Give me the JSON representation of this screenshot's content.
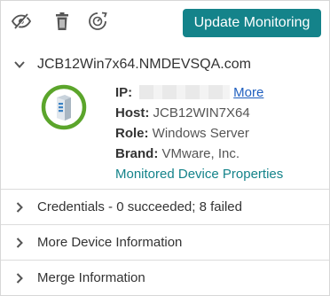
{
  "toolbar": {
    "hide_icon": "eye-slash-icon",
    "delete_icon": "trash-icon",
    "refresh_icon": "refresh-scan-icon",
    "update_button_label": "Update Monitoring",
    "accent_color": "#14838a"
  },
  "device": {
    "name": "JCB12Win7x64.NMDEVSQA.com",
    "expanded": true,
    "status_icon": "server-icon",
    "status_color": "#5ba52b",
    "properties": {
      "ip_label": "IP:",
      "ip_more_link": "More",
      "host_label": "Host:",
      "host_value": "JCB12WIN7X64",
      "role_label": "Role:",
      "role_value": "Windows Server",
      "brand_label": "Brand:",
      "brand_value": "VMware, Inc.",
      "properties_link": "Monitored Device Properties"
    }
  },
  "sections": {
    "credentials": "Credentials - 0 succeeded; 8 failed",
    "more_device_info": "More Device Information",
    "merge_info": "Merge Information"
  }
}
